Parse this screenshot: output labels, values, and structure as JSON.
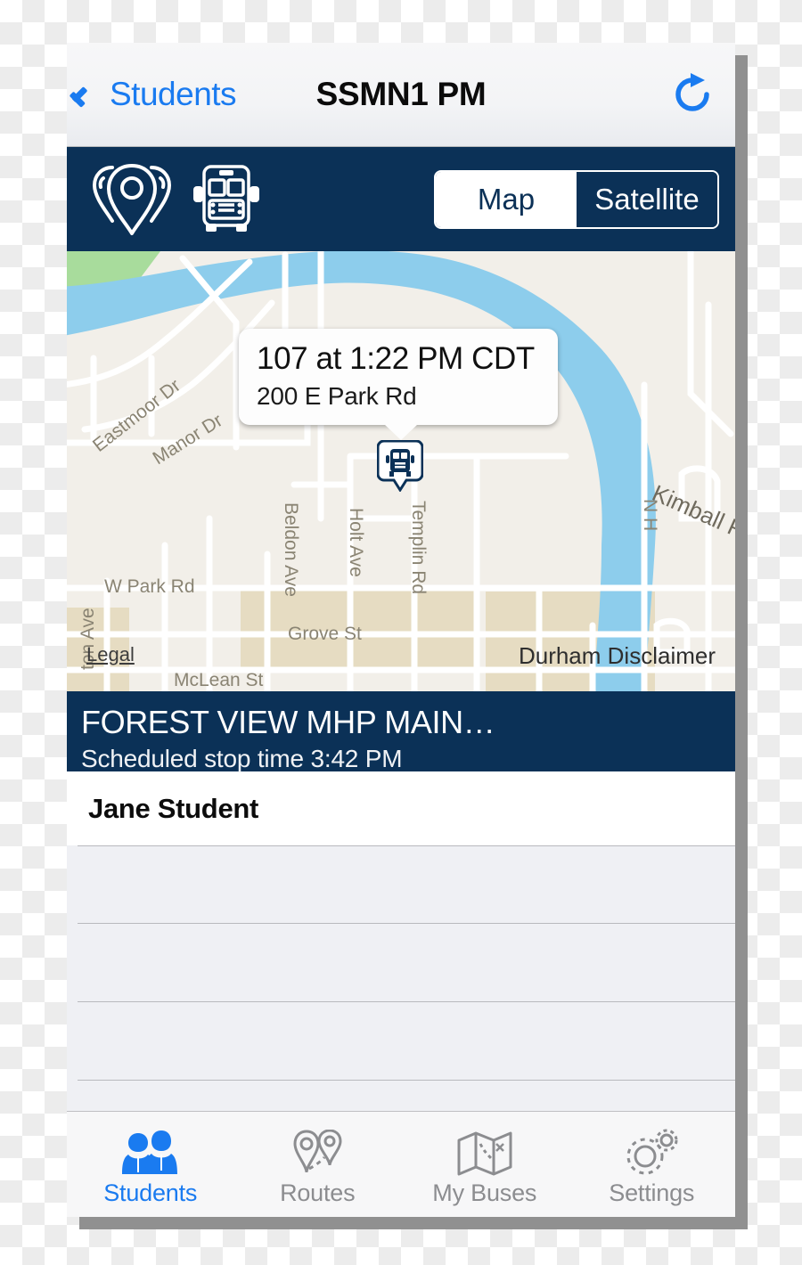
{
  "navbar": {
    "back_label": "Students",
    "title": "SSMN1 PM",
    "refresh_icon": "refresh-icon",
    "back_icon": "chevron-left-icon"
  },
  "map_toolbar": {
    "pins_icon": "map-pins-icon",
    "bus_icon": "school-bus-icon",
    "segment": {
      "options": [
        "Map",
        "Satellite"
      ],
      "selected": "Map",
      "map_label": "Map",
      "satellite_label": "Satellite"
    }
  },
  "map": {
    "callout": {
      "title": "107 at 1:22 PM CDT",
      "subtitle": "200 E Park Rd"
    },
    "bus_marker_icon": "bus-marker-icon",
    "legal_link": "Legal",
    "disclaimer": "Durham Disclaimer",
    "street_labels": [
      "Eastmoor Dr",
      "Manor Dr",
      "Beldon Ave",
      "Holt Ave",
      "Templin Rd",
      "W Park Rd",
      "Grove St",
      "McLean St",
      "Kimball Rd",
      "ton Ave",
      "N H"
    ]
  },
  "stop": {
    "name": "FOREST VIEW MHP MAIN…",
    "scheduled": "Scheduled stop time 3:42 PM"
  },
  "students": [
    {
      "name": "Jane Student"
    }
  ],
  "empty_rows": [
    1,
    2,
    3
  ],
  "tab_bar": {
    "tabs": [
      {
        "label": "Students",
        "icon": "students-icon",
        "active": true
      },
      {
        "label": "Routes",
        "icon": "routes-pins-icon",
        "active": false
      },
      {
        "label": "My Buses",
        "icon": "folded-map-icon",
        "active": false
      },
      {
        "label": "Settings",
        "icon": "gears-icon",
        "active": false
      }
    ]
  },
  "colors": {
    "navy": "#0b3157",
    "accent_blue": "#1a7bf0",
    "tab_inactive": "#8c8d90",
    "map_land": "#f2efe9",
    "map_water": "#8dcdec",
    "map_park": "#a8dc9c",
    "list_empty_bg": "#eff0f4"
  }
}
